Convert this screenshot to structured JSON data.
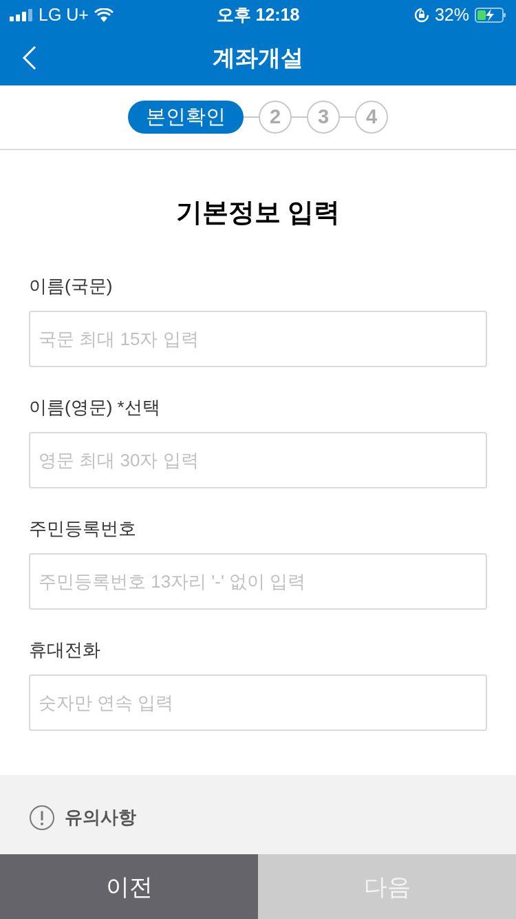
{
  "status_bar": {
    "carrier": "LG U+",
    "time": "오후 12:18",
    "battery": "32%"
  },
  "header": {
    "title": "계좌개설"
  },
  "steps": [
    {
      "label": "본인확인",
      "selected": true
    },
    {
      "label": "2",
      "selected": false
    },
    {
      "label": "3",
      "selected": false
    },
    {
      "label": "4",
      "selected": false
    }
  ],
  "form": {
    "title": "기본정보 입력",
    "fields": [
      {
        "label": "이름(국문)",
        "placeholder": "국문 최대 15자 입력"
      },
      {
        "label": "이름(영문) *선택",
        "placeholder": "영문 최대 30자 입력"
      },
      {
        "label": "주민등록번호",
        "placeholder": "주민등록번호 13자리 '-' 없이 입력"
      },
      {
        "label": "휴대전화",
        "placeholder": "숫자만 연속 입력"
      }
    ]
  },
  "notice": {
    "title": "유의사항"
  },
  "buttons": [
    {
      "label": "이전",
      "disabled": false
    },
    {
      "label": "다음",
      "disabled": true
    }
  ]
}
